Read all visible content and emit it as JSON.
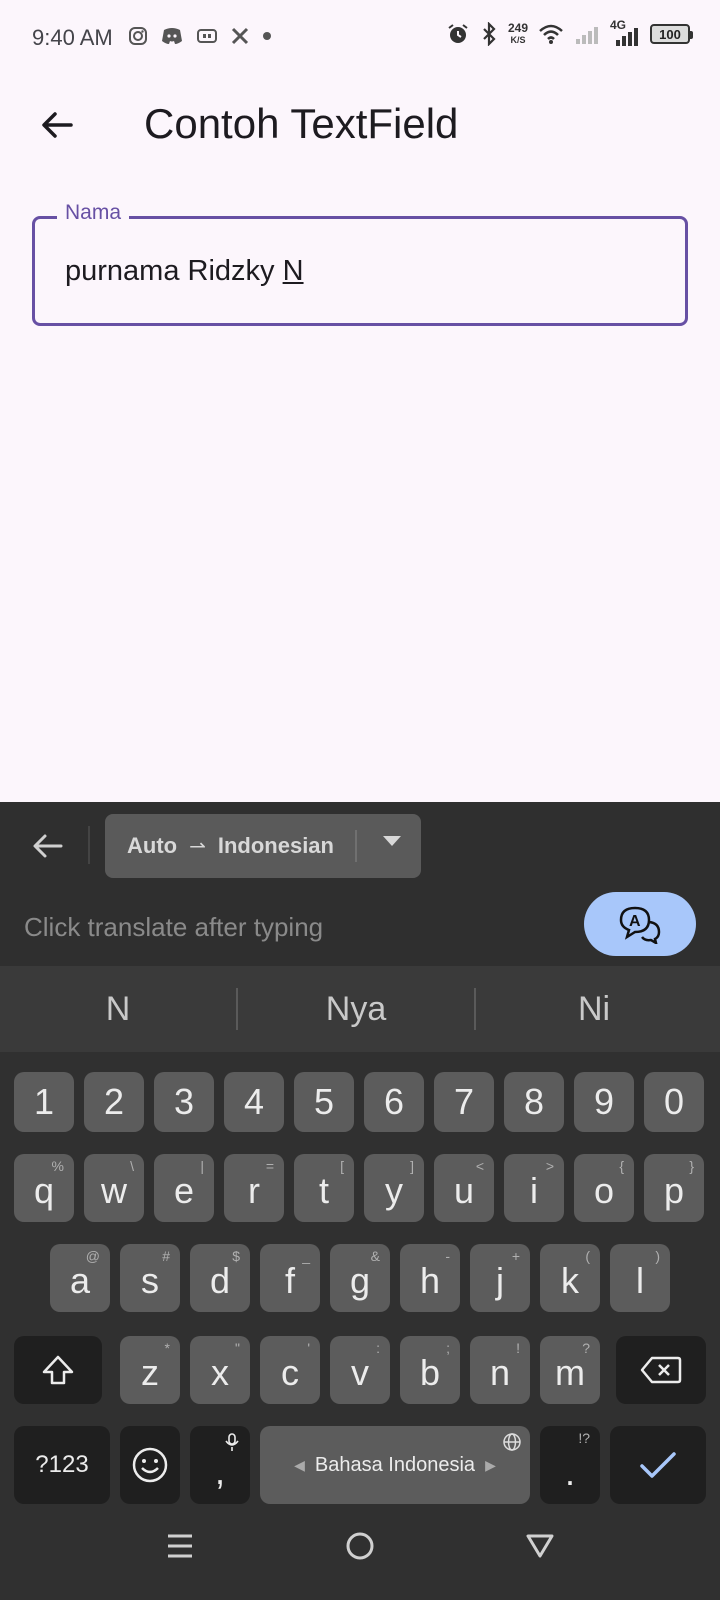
{
  "status_bar": {
    "time": "9:40 AM",
    "net_speed_value": "249",
    "net_speed_unit": "K/S",
    "network_type": "4G",
    "battery": "100",
    "left_icons": [
      "instagram-icon",
      "discord-icon",
      "app-icon",
      "x-icon",
      "dot-icon"
    ],
    "right_icons": [
      "alarm-icon",
      "bluetooth-icon",
      "wifi-icon",
      "signal-icon",
      "signal-icon-4g"
    ]
  },
  "app_bar": {
    "title": "Contoh TextField"
  },
  "text_field": {
    "label": "Nama",
    "value_committed": "purnama Ridzky ",
    "value_composing": "N"
  },
  "keyboard": {
    "translate_bar": {
      "source_lang": "Auto",
      "target_lang": "Indonesian",
      "placeholder": "Click translate after typing"
    },
    "suggestions": [
      "N",
      "Nya",
      "Ni"
    ],
    "number_row": [
      "1",
      "2",
      "3",
      "4",
      "5",
      "6",
      "7",
      "8",
      "9",
      "0"
    ],
    "row1": [
      {
        "key": "q",
        "hint": "%"
      },
      {
        "key": "w",
        "hint": "\\"
      },
      {
        "key": "e",
        "hint": "|"
      },
      {
        "key": "r",
        "hint": "="
      },
      {
        "key": "t",
        "hint": "["
      },
      {
        "key": "y",
        "hint": "]"
      },
      {
        "key": "u",
        "hint": "<"
      },
      {
        "key": "i",
        "hint": ">"
      },
      {
        "key": "o",
        "hint": "{"
      },
      {
        "key": "p",
        "hint": "}"
      }
    ],
    "row2": [
      {
        "key": "a",
        "hint": "@"
      },
      {
        "key": "s",
        "hint": "#"
      },
      {
        "key": "d",
        "hint": "$"
      },
      {
        "key": "f",
        "hint": "_"
      },
      {
        "key": "g",
        "hint": "&"
      },
      {
        "key": "h",
        "hint": "-"
      },
      {
        "key": "j",
        "hint": "+"
      },
      {
        "key": "k",
        "hint": "("
      },
      {
        "key": "l",
        "hint": ")"
      }
    ],
    "row3": [
      {
        "key": "z",
        "hint": "*"
      },
      {
        "key": "x",
        "hint": "\""
      },
      {
        "key": "c",
        "hint": "'"
      },
      {
        "key": "v",
        "hint": ":"
      },
      {
        "key": "b",
        "hint": ";"
      },
      {
        "key": "n",
        "hint": "!"
      },
      {
        "key": "m",
        "hint": "?"
      }
    ],
    "symbols_label": "?123",
    "comma": ",",
    "space_label": "Bahasa Indonesia",
    "period": ".",
    "period_hint": "!?",
    "accent_color": "#a8c7fa"
  },
  "colors": {
    "primary": "#6750a4",
    "background": "#fcf6fc",
    "keyboard_bg": "#303030"
  }
}
